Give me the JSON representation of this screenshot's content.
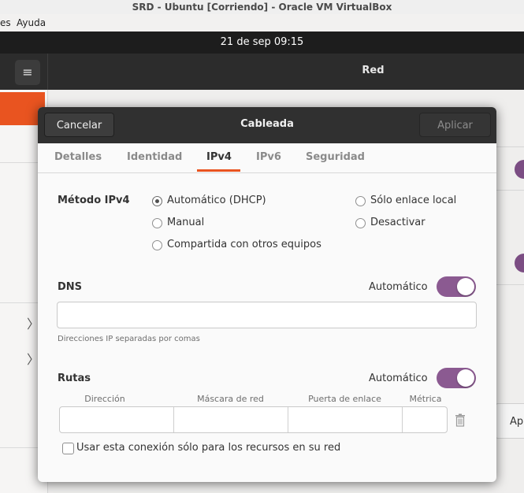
{
  "vbox": {
    "title": "SRD - Ubuntu [Corriendo] - Oracle VM VirtualBox",
    "menu": [
      "es",
      "Ayuda"
    ]
  },
  "topbar": {
    "datetime": "21 de sep  09:15"
  },
  "settings": {
    "title": "Red",
    "menu_icon": "≡",
    "chevron": "〉",
    "partial_button": "Ap"
  },
  "dialog": {
    "cancel_label": "Cancelar",
    "title": "Cableada",
    "apply_label": "Aplicar",
    "tabs": [
      "Detalles",
      "Identidad",
      "IPv4",
      "IPv6",
      "Seguridad"
    ],
    "active_tab": "IPv4",
    "ipv4": {
      "method_label": "Método IPv4",
      "methods": [
        "Automático (DHCP)",
        "Sólo enlace local",
        "Manual",
        "Desactivar",
        "Compartida con otros equipos"
      ],
      "selected_method": "Automático (DHCP)",
      "dns_label": "DNS",
      "dns_auto_label": "Automático",
      "dns_auto": true,
      "dns_value": "",
      "dns_hint": "Direcciones IP separadas por comas",
      "routes_label": "Rutas",
      "routes_auto_label": "Automático",
      "routes_auto": true,
      "route_columns": [
        "Dirección",
        "Máscara de red",
        "Puerta de enlace",
        "Métrica"
      ],
      "only_resources_label": "Usar esta conexión sólo para los recursos en su red",
      "only_resources_checked": false
    }
  }
}
